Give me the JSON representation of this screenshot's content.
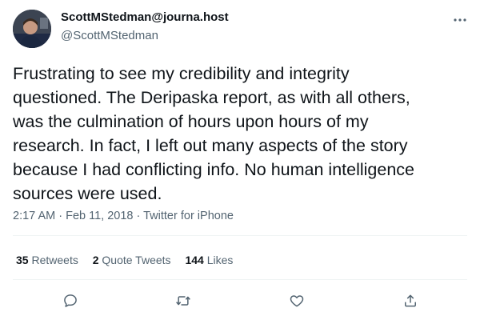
{
  "author": {
    "display_name": "ScottMStedman@journa.host",
    "handle": "@ScottMStedman"
  },
  "tweet": {
    "text": "Frustrating to see my credibility and integrity\nquestioned. The Deripaska report, as with all others,\nwas the culmination of hours upon hours of my\nresearch. In fact, I left out many aspects of the story\nbecause I had conflicting info. No human intelligence\nsources were used.",
    "time": "2:17 AM",
    "date": "Feb 11, 2018",
    "source": "Twitter for iPhone"
  },
  "stats": {
    "retweets_count": "35",
    "retweets_label": "Retweets",
    "quote_count": "2",
    "quote_label": "Quote Tweets",
    "likes_count": "144",
    "likes_label": "Likes"
  },
  "icons": {
    "more": "more-horizontal-icon",
    "reply": "reply-icon",
    "retweet": "retweet-icon",
    "like": "heart-icon",
    "share": "share-icon"
  },
  "colors": {
    "text": "#0f1419",
    "secondary": "#536471",
    "divider": "#eff3f4"
  }
}
